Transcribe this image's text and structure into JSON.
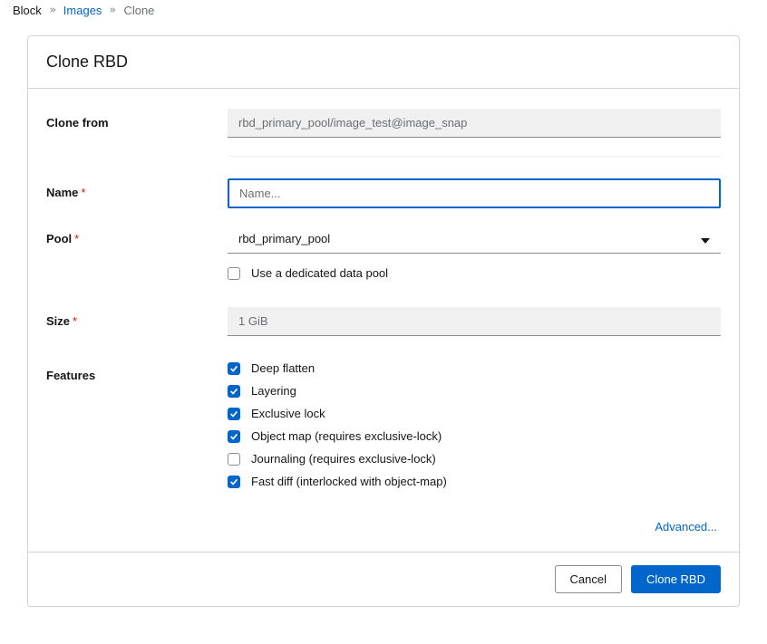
{
  "breadcrumb": {
    "block": "Block",
    "images": "Images",
    "clone": "Clone"
  },
  "header": {
    "title": "Clone RBD"
  },
  "form": {
    "clone_from_label": "Clone from",
    "clone_from_value": "rbd_primary_pool/image_test@image_snap",
    "name_label": "Name",
    "name_placeholder": "Name...",
    "name_value": "",
    "pool_label": "Pool",
    "pool_value": "rbd_primary_pool",
    "dedicated_pool_label": "Use a dedicated data pool",
    "dedicated_pool_checked": false,
    "size_label": "Size",
    "size_value": "1 GiB",
    "features_label": "Features",
    "features": [
      {
        "label": "Deep flatten",
        "checked": true
      },
      {
        "label": "Layering",
        "checked": true
      },
      {
        "label": "Exclusive lock",
        "checked": true
      },
      {
        "label": "Object map (requires exclusive-lock)",
        "checked": true
      },
      {
        "label": "Journaling (requires exclusive-lock)",
        "checked": false
      },
      {
        "label": "Fast diff (interlocked with object-map)",
        "checked": true
      }
    ],
    "advanced_label": "Advanced..."
  },
  "footer": {
    "cancel": "Cancel",
    "submit": "Clone RBD"
  }
}
